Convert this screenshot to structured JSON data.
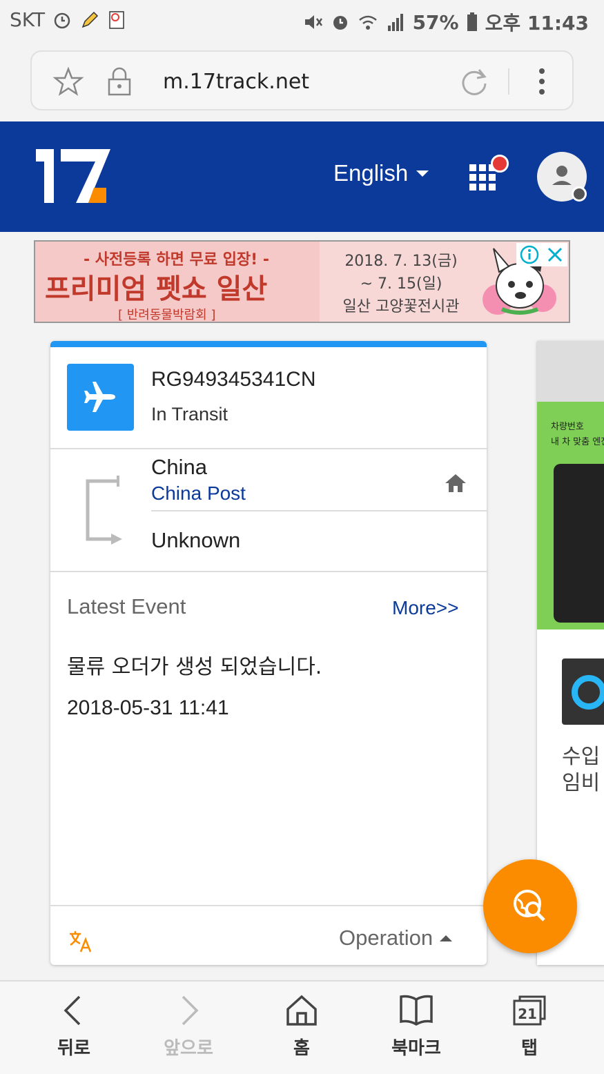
{
  "status_bar": {
    "carrier": "SKT",
    "battery": "57%",
    "time": "오후 11:43"
  },
  "browser": {
    "url": "m.17track.net"
  },
  "header": {
    "language": "English"
  },
  "ad": {
    "line1": "- 사전등록 하면 무료 입장! -",
    "line2": "프리미엄 펫쇼 일산",
    "line3": "[ 반려동물박람회 ]",
    "date1": "2018. 7. 13(금)",
    "date2": "~ 7. 15(일)",
    "venue": "일산 고양꽃전시관"
  },
  "shipment": {
    "tracking_number": "RG949345341CN",
    "status": "In Transit",
    "origin_country": "China",
    "carrier": "China Post",
    "destination": "Unknown",
    "latest_event_label": "Latest Event",
    "more_label": "More>>",
    "event_description": "물류 오더가 생성 되었습니다.",
    "event_time": "2018-05-31 11:41",
    "operation_label": "Operation"
  },
  "side_card": {
    "ad_line1": "차량번호",
    "ad_line2": "내 차 맞춤 엔진",
    "text_line1": "수입",
    "text_line2": "임비"
  },
  "bottom_nav": {
    "back": "뒤로",
    "forward": "앞으로",
    "home": "홈",
    "bookmarks": "북마크",
    "tabs": "탭",
    "tab_count": "21"
  },
  "colors": {
    "header_bg": "#0b3a9a",
    "accent_blue": "#2196f3",
    "fab_orange": "#fb8c00",
    "link_blue": "#0b3a9a"
  }
}
